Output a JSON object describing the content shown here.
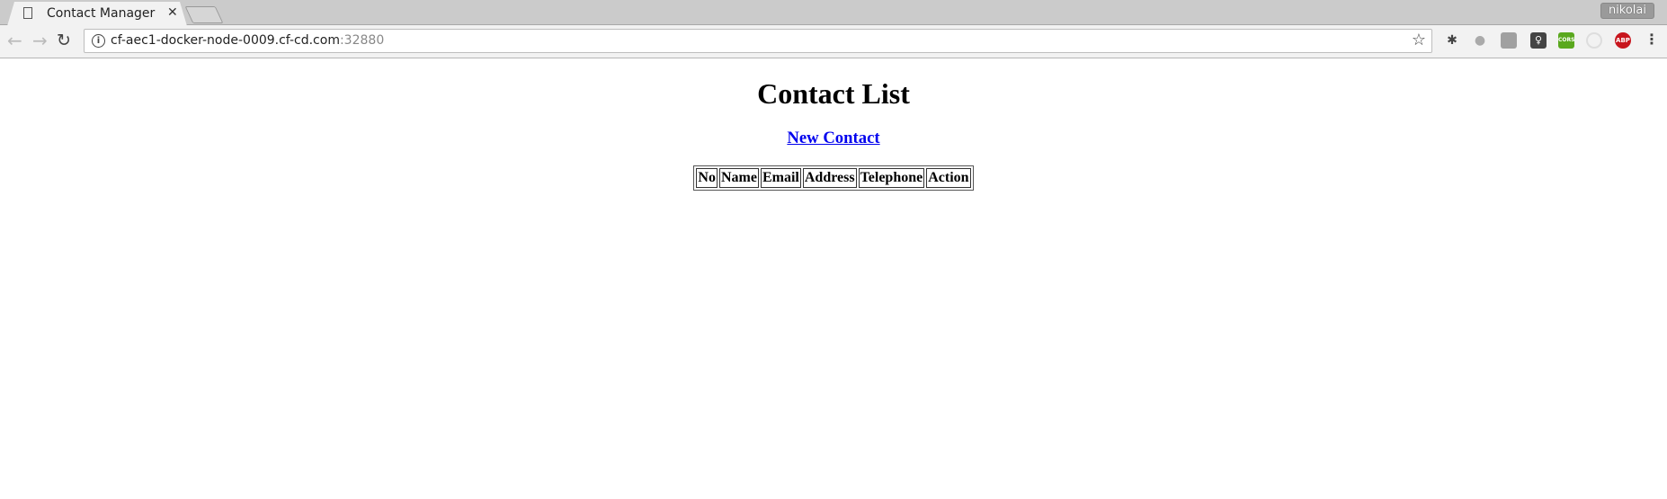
{
  "browser": {
    "tab_title": "Contact Manager H",
    "user": "nikolai",
    "url_host": "cf-aec1-docker-node-0009.cf-cd.com",
    "url_port": ":32880",
    "extensions": [
      "bug-extension",
      "paw-extension",
      "puzzle-extension",
      "lightbulb-extension",
      "cors-extension",
      "swirl-extension",
      "adblock-extension"
    ],
    "cors_label": "CORS",
    "abp_label": "ABP"
  },
  "page": {
    "title": "Contact List",
    "new_contact_link": "New Contact",
    "table_headers": [
      "No",
      "Name",
      "Email",
      "Address",
      "Telephone",
      "Action"
    ]
  }
}
